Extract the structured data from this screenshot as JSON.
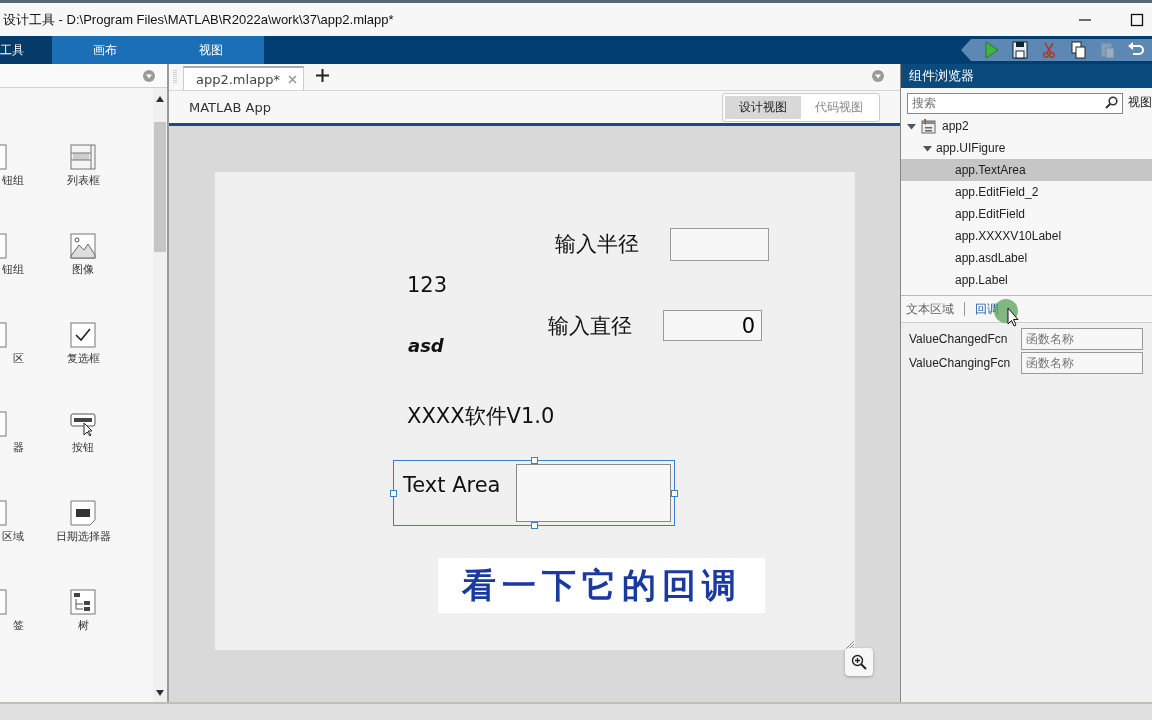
{
  "window": {
    "title": "设计工具 - D:\\Program Files\\MATLAB\\R2022a\\work\\37\\app2.mlapp*"
  },
  "ribbon_tabs": [
    {
      "label": "工具",
      "kind": "main"
    },
    {
      "label": "画布",
      "kind": "contextual"
    },
    {
      "label": "视图",
      "kind": "contextual"
    }
  ],
  "quick_access": [
    {
      "kind": "run",
      "disabled": false
    },
    {
      "kind": "save",
      "disabled": false
    },
    {
      "kind": "cut",
      "disabled": false
    },
    {
      "kind": "copy",
      "disabled": false
    },
    {
      "kind": "paste",
      "disabled": true
    },
    {
      "kind": "undo",
      "disabled": false
    }
  ],
  "palette": {
    "items": [
      {
        "label": "钮组",
        "kind": "partial"
      },
      {
        "label": "列表框",
        "kind": "listbox"
      },
      {
        "label": "钮组",
        "kind": "partial"
      },
      {
        "label": "图像",
        "kind": "image"
      },
      {
        "label": "区",
        "kind": "partial"
      },
      {
        "label": "复选框",
        "kind": "checkbox"
      },
      {
        "label": "器",
        "kind": "partial"
      },
      {
        "label": "按钮",
        "kind": "button"
      },
      {
        "label": "区域",
        "kind": "partial"
      },
      {
        "label": "日期选择器",
        "kind": "date"
      },
      {
        "label": "签",
        "kind": "partial"
      },
      {
        "label": "树",
        "kind": "tree"
      }
    ]
  },
  "document_tabs": [
    {
      "label": "app2.mlapp*",
      "selected": true
    }
  ],
  "app_title": "MATLAB App",
  "view_switch": [
    {
      "label": "设计视图",
      "selected": true
    },
    {
      "label": "代码视图",
      "selected": false
    }
  ],
  "canvas": {
    "components": [
      {
        "kind": "label",
        "text": "输入半径"
      },
      {
        "kind": "edit_field"
      },
      {
        "kind": "label",
        "text": "123"
      },
      {
        "kind": "label",
        "text": "输入直径"
      },
      {
        "kind": "numeric_field",
        "value": "0"
      },
      {
        "kind": "emphasis_label",
        "text": "asd"
      },
      {
        "kind": "label",
        "text": "XXXX软件V1.0"
      },
      {
        "kind": "text_area",
        "label": "Text Area",
        "selected": true
      }
    ],
    "caption": "看一下它的回调"
  },
  "component_browser": {
    "title": "组件浏览器",
    "search": {
      "placeholder": "搜索"
    },
    "view_label": "视图",
    "tree": [
      {
        "label": "app2",
        "expanded": true,
        "selected": false,
        "children": [
          {
            "label": "app.UIFigure",
            "expanded": true,
            "selected": false,
            "children": [
              {
                "label": "app.TextArea",
                "selected": true
              },
              {
                "label": "app.EditField_2",
                "selected": false
              },
              {
                "label": "app.EditField",
                "selected": false
              },
              {
                "label": "app.XXXXV10Label",
                "selected": false
              },
              {
                "label": "app.asdLabel",
                "selected": false
              },
              {
                "label": "app.Label",
                "selected": false
              }
            ]
          }
        ]
      }
    ],
    "inspector_tabs": [
      {
        "label": "文本区域",
        "selected": false
      },
      {
        "label": "回调",
        "selected": true
      }
    ],
    "properties": [
      {
        "name": "ValueChangedFcn",
        "placeholder": "函数名称"
      },
      {
        "name": "ValueChangingFcn",
        "placeholder": "函数名称"
      }
    ]
  }
}
